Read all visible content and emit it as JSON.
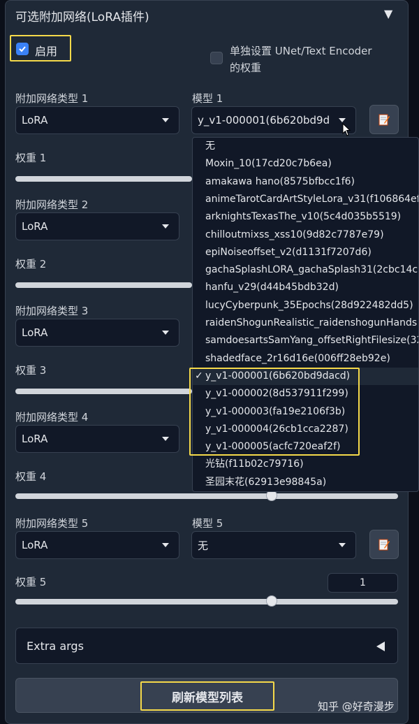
{
  "header": {
    "title": "可选附加网络(LoRA插件)"
  },
  "enable": {
    "label": "启用",
    "checked": true
  },
  "unet_option": {
    "label_line1": "单独设置 UNet/Text Encoder",
    "label_line2": "的权重",
    "checked": false
  },
  "rows": [
    {
      "type_label": "附加网络类型 1",
      "type_value": "LoRA",
      "model_label": "模型 1",
      "model_value": "y_v1-000001(6b620bd9d",
      "weight_label": "权重 1"
    },
    {
      "type_label": "附加网络类型 2",
      "type_value": "LoRA",
      "weight_label": "权重 2"
    },
    {
      "type_label": "附加网络类型 3",
      "type_value": "LoRA",
      "weight_label": "权重 3"
    },
    {
      "type_label": "附加网络类型 4",
      "type_value": "LoRA",
      "weight_label": "权重 4",
      "weight_value": 0.67
    },
    {
      "type_label": "附加网络类型 5",
      "type_value": "LoRA",
      "model_label": "模型 5",
      "model_value": "无",
      "weight_label": "权重 5",
      "weight_value": 0.67,
      "weight_number": "1"
    }
  ],
  "dropdown": {
    "items": [
      "无",
      "Moxin_10(17cd20c7b6ea)",
      "amakawa hano(8575bfbcc1f6)",
      "animeTarotCardArtStyleLora_v31(f106864ef",
      "arknightsTexasThe_v10(5c4d035b5519)",
      "chilloutmixss_xss10(9d82c7787e79)",
      "epiNoiseoffset_v2(d1131f7207d6)",
      "gachaSplashLORA_gachaSplash31(2cbc14c",
      "hanfu_v29(d44b45bdb32d)",
      "lucyCyberpunk_35Epochs(28d922482dd5)",
      "raidenShogunRealistic_raidenshogunHands",
      "samdoesartsSamYang_offsetRightFilesize(32",
      "shadedface_2r16d16e(006ff28eb92e)",
      "y_v1-000001(6b620bd9dacd)",
      "y_v1-000002(8d537911f299)",
      "y_v1-000003(fa19e2106f3b)",
      "y_v1-000004(26cb1cca2287)",
      "y_v1-000005(acfc720eaf2f)",
      "光钻(f11b02c79716)",
      "圣园末花(62913e98845a)"
    ],
    "selected_index": 13,
    "check_mark": "✓"
  },
  "extra_args": {
    "label": "Extra args"
  },
  "refresh": {
    "label": "刷新模型列表"
  },
  "watermark": {
    "text": "知乎 @好奇漫步"
  },
  "colors": {
    "accent": "#3b82f6",
    "highlight": "#f5d94a",
    "panel": "#1f2937",
    "background": "#0b0f19"
  }
}
